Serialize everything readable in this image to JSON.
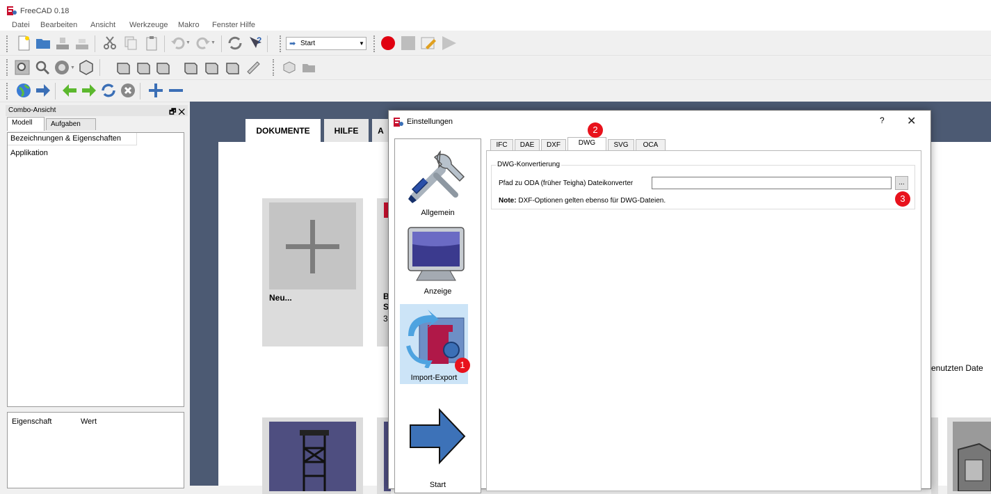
{
  "window": {
    "title": "FreeCAD 0.18"
  },
  "menubar": {
    "items": [
      "Datei",
      "Bearbeiten",
      "Ansicht",
      "Werkzeuge",
      "Makro",
      "Fenster",
      "Hilfe"
    ]
  },
  "toolbar": {
    "workbench_select": "Start"
  },
  "combo_view": {
    "title": "Combo-Ansicht",
    "header_buttons": "🗗 ✕",
    "tabs": [
      "Modell",
      "Aufgaben"
    ],
    "tree_header": "Bezeichnungen & Eigenschaften",
    "tree_item": "Applikation",
    "property_columns": [
      "Eigenschaft",
      "Wert"
    ]
  },
  "start_page": {
    "tabs": [
      "DOKUMENTE",
      "HILFE",
      "A"
    ],
    "new_card_label": "Neu...",
    "card2_partial": [
      "B",
      "S",
      "3"
    ],
    "recent_files_partial": "enutzten Date"
  },
  "dialog": {
    "title": "Einstellungen",
    "help_button": "?",
    "close_button": "✕",
    "categories": [
      "Allgemein",
      "Anzeige",
      "Import-Export",
      "Start"
    ],
    "selected_category": "Import-Export",
    "tabs": [
      "IFC",
      "DAE",
      "DXF",
      "DWG",
      "SVG",
      "OCA"
    ],
    "active_tab": "DWG",
    "group_title": "DWG-Konvertierung",
    "path_label": "Pfad zu ODA (früher Teigha) Dateikonverter",
    "path_value": "",
    "browse_label": "...",
    "note_bold": "Note:",
    "note_text": " DXF-Optionen gelten ebenso für DWG-Dateien."
  },
  "annotations": {
    "badge1": "1",
    "badge2": "2",
    "badge3": "3"
  },
  "colors": {
    "accent_red": "#e8121c",
    "main_bg": "#4c5a73",
    "selection": "#cce4f7"
  }
}
